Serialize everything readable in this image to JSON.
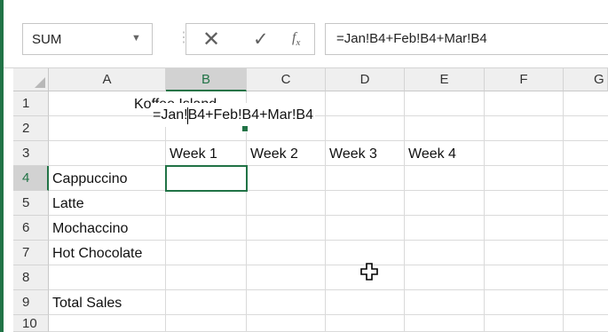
{
  "name_box": {
    "value": "SUM"
  },
  "formula_bar": {
    "value": "=Jan!B4+Feb!B4+Mar!B4"
  },
  "toolbar": {
    "fx_label": "fx",
    "cancel_glyph": "✕",
    "enter_glyph": "✓"
  },
  "columns": [
    "A",
    "B",
    "C",
    "D",
    "E",
    "F",
    "G"
  ],
  "rows": [
    "1",
    "2",
    "3",
    "4",
    "5",
    "6",
    "7",
    "8",
    "9",
    "10"
  ],
  "cells": {
    "title": "Koffee Island",
    "week1": "Week 1",
    "week2": "Week 2",
    "week3": "Week 3",
    "week4": "Week 4",
    "a4": "Cappuccino",
    "a5": "Latte",
    "a6": "Mochaccino",
    "a7": "Hot Chocolate",
    "a9": "Total Sales",
    "b4_editing": "=Jan!B4+Feb!B4+Mar!B4"
  },
  "icons": {
    "cursor": "crosshair-cursor-icon",
    "dropdown": "chevron-down-icon"
  },
  "colors": {
    "accent": "#217346",
    "header_bg": "#efefef",
    "selected_header_bg": "#d2d2d2"
  }
}
